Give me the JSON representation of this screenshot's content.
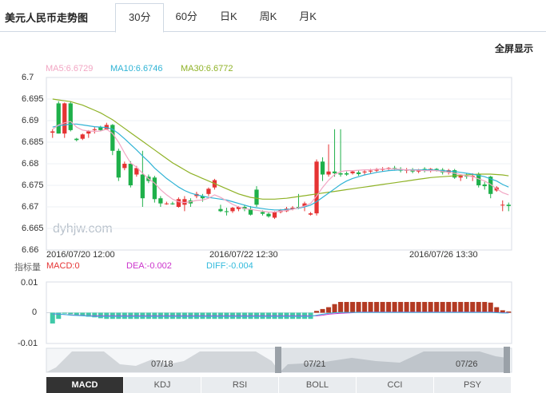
{
  "title": "美元人民币走势图",
  "tabs": [
    {
      "label": "30分",
      "active": true
    },
    {
      "label": "60分",
      "active": false
    },
    {
      "label": "日K",
      "active": false
    },
    {
      "label": "周K",
      "active": false
    },
    {
      "label": "月K",
      "active": false
    }
  ],
  "fullscreen_label": "全屏显示",
  "watermark": "dyhjw.com",
  "legend": {
    "ma5": "MA5:6.6729",
    "ma10": "MA10:6.6746",
    "ma30": "MA30:6.6772"
  },
  "colors": {
    "up": "#e53333",
    "down": "#1fb04a",
    "ma5": "#f2a6c3",
    "ma10": "#2fb3d5",
    "ma30": "#8fb227",
    "dea": "#cc33cc",
    "diff": "#33bbdd",
    "macd_neg": "#3fc9a8",
    "macd_pos": "#b33a22"
  },
  "indicator": {
    "label": "指标量",
    "macd": "MACD:0",
    "dea": "DEA:-0.002",
    "diff": "DIFF:-0.004"
  },
  "navigator_dates": [
    "07/18",
    "07/21",
    "07/26"
  ],
  "bottom_tabs": [
    {
      "label": "MACD",
      "active": true
    },
    {
      "label": "KDJ",
      "active": false
    },
    {
      "label": "RSI",
      "active": false
    },
    {
      "label": "BOLL",
      "active": false
    },
    {
      "label": "CCI",
      "active": false
    },
    {
      "label": "PSY",
      "active": false
    }
  ],
  "chart_data": {
    "type": "candlestick",
    "y_ticks": [
      "6.7",
      "6.695",
      "6.69",
      "6.685",
      "6.68",
      "6.675",
      "6.67",
      "6.665",
      "6.66"
    ],
    "ylim": [
      6.66,
      6.7
    ],
    "x_ticks": [
      "2016/07/20 12:00",
      "2016/07/22 12:30",
      "2016/07/26 13:30"
    ],
    "candles": [
      [
        6.6872,
        6.688,
        6.686,
        6.6875
      ],
      [
        6.694,
        6.6945,
        6.687,
        6.687
      ],
      [
        6.687,
        6.6942,
        6.686,
        6.694
      ],
      [
        6.694,
        6.6945,
        6.6875,
        6.6878
      ],
      [
        6.6858,
        6.686,
        6.6852,
        6.6855
      ],
      [
        6.6858,
        6.687,
        6.6855,
        6.6868
      ],
      [
        6.687,
        6.6878,
        6.686,
        6.6875
      ],
      [
        6.6878,
        6.6885,
        6.687,
        6.688
      ],
      [
        6.6885,
        6.6888,
        6.6875,
        6.6878
      ],
      [
        6.688,
        6.6895,
        6.6878,
        6.689
      ],
      [
        6.689,
        6.6892,
        6.682,
        6.683
      ],
      [
        6.683,
        6.6835,
        6.676,
        6.6768
      ],
      [
        6.679,
        6.6805,
        6.6785,
        6.68
      ],
      [
        6.68,
        6.6806,
        6.6745,
        6.675
      ],
      [
        6.6775,
        6.6795,
        6.677,
        6.679
      ],
      [
        6.6775,
        6.683,
        6.67,
        6.672
      ],
      [
        6.677,
        6.6775,
        6.6755,
        6.676
      ],
      [
        6.6768,
        6.6772,
        6.671,
        6.6718
      ],
      [
        6.672,
        6.6725,
        6.67,
        6.6708
      ],
      [
        6.6708,
        6.6712,
        6.6705,
        6.6708
      ],
      [
        6.6708,
        6.6712,
        6.6705,
        6.6706
      ],
      [
        6.67,
        6.6722,
        6.6698,
        6.6718
      ],
      [
        6.6705,
        6.6725,
        6.669,
        6.6718
      ],
      [
        6.6715,
        6.672,
        6.67,
        6.6708
      ],
      [
        6.6725,
        6.6735,
        6.672,
        6.673
      ],
      [
        6.6725,
        6.673,
        6.6712,
        6.672
      ],
      [
        6.673,
        6.6745,
        6.6725,
        6.6742
      ],
      [
        6.6745,
        6.6765,
        6.674,
        6.6762
      ],
      [
        6.6695,
        6.6705,
        6.6688,
        6.669
      ],
      [
        6.669,
        6.6698,
        6.668,
        6.6688
      ],
      [
        6.669,
        6.67,
        6.6686,
        6.6698
      ],
      [
        6.6695,
        6.6702,
        6.669,
        6.67
      ],
      [
        6.67,
        6.6705,
        6.669,
        6.6695
      ],
      [
        6.6695,
        6.6702,
        6.668,
        6.6682
      ],
      [
        6.674,
        6.6748,
        6.67,
        6.6705
      ],
      [
        6.6688,
        6.6692,
        6.668,
        6.6684
      ],
      [
        6.6684,
        6.6688,
        6.6675,
        6.6678
      ],
      [
        6.6675,
        6.669,
        6.6672,
        6.6688
      ],
      [
        6.6688,
        6.6695,
        6.6685,
        6.6692
      ],
      [
        6.669,
        6.67,
        6.6688,
        6.6696
      ],
      [
        6.6695,
        6.6702,
        6.6692,
        6.6698
      ],
      [
        6.67,
        6.673,
        6.6695,
        6.6698
      ],
      [
        6.67,
        6.6712,
        6.669,
        6.6708
      ],
      [
        6.6682,
        6.6688,
        6.668,
        6.6685
      ],
      [
        6.6685,
        6.681,
        6.668,
        6.6805
      ],
      [
        6.6805,
        6.6815,
        6.676,
        6.6775
      ],
      [
        6.6775,
        6.6845,
        6.677,
        6.6782
      ],
      [
        6.6782,
        6.688,
        6.677,
        6.6778
      ],
      [
        6.6778,
        6.688,
        6.677,
        6.6775
      ],
      [
        6.6778,
        6.6782,
        6.6772,
        6.6775
      ],
      [
        6.6778,
        6.6785,
        6.6775,
        6.6782
      ],
      [
        6.678,
        6.6785,
        6.6772,
        6.6776
      ],
      [
        6.678,
        6.6785,
        6.6775,
        6.6782
      ],
      [
        6.6782,
        6.6788,
        6.6778,
        6.6784
      ],
      [
        6.6784,
        6.679,
        6.678,
        6.6786
      ],
      [
        6.6786,
        6.6792,
        6.6782,
        6.6788
      ],
      [
        6.6788,
        6.6792,
        6.6784,
        6.679
      ],
      [
        6.679,
        6.6795,
        6.6786,
        6.6788
      ],
      [
        6.6788,
        6.6792,
        6.678,
        6.6784
      ],
      [
        6.6784,
        6.679,
        6.6778,
        6.6786
      ],
      [
        6.6786,
        6.679,
        6.6778,
        6.6782
      ],
      [
        6.6782,
        6.6788,
        6.6778,
        6.6786
      ],
      [
        6.6788,
        6.6792,
        6.678,
        6.6784
      ],
      [
        6.6784,
        6.679,
        6.678,
        6.6788
      ],
      [
        6.6788,
        6.679,
        6.6782,
        6.6786
      ],
      [
        6.6786,
        6.679,
        6.6775,
        6.678
      ],
      [
        6.678,
        6.6788,
        6.6775,
        6.6785
      ],
      [
        6.6785,
        6.6788,
        6.6765,
        6.6768
      ],
      [
        6.6768,
        6.6775,
        6.676,
        6.6772
      ],
      [
        6.6772,
        6.6778,
        6.6765,
        6.677
      ],
      [
        6.677,
        6.6778,
        6.676,
        6.6772
      ],
      [
        6.6775,
        6.678,
        6.6745,
        6.675
      ],
      [
        6.6752,
        6.6758,
        6.674,
        6.6748
      ],
      [
        6.677,
        6.6772,
        6.672,
        6.673
      ],
      [
        6.6738,
        6.6748,
        6.6735,
        6.6745
      ],
      [
        6.6705,
        6.6715,
        6.669,
        6.6705
      ],
      [
        6.6705,
        6.671,
        6.669,
        6.6702
      ]
    ],
    "ma5": [
      6.688,
      6.689,
      6.6895,
      6.6898,
      6.6885,
      6.6878,
      6.6876,
      6.6875,
      6.6876,
      6.688,
      6.687,
      6.685,
      6.6825,
      6.6802,
      6.6792,
      6.6778,
      6.6765,
      6.6755,
      6.674,
      6.6728,
      6.6718,
      6.6712,
      6.671,
      6.6712,
      6.6715,
      6.6716,
      6.672,
      6.6728,
      6.6722,
      6.6714,
      6.6706,
      6.67,
      6.6696,
      6.6694,
      6.6692,
      6.669,
      6.6688,
      6.6688,
      6.669,
      6.6692,
      6.6694,
      6.6698,
      6.6702,
      6.6708,
      6.6725,
      6.6745,
      6.6762,
      6.6775,
      6.6782,
      6.6784,
      6.6784,
      6.6785,
      6.6786,
      6.6786,
      6.6787,
      6.6788,
      6.6788,
      6.6788,
      6.6787,
      6.6786,
      6.6785,
      6.6785,
      6.6784,
      6.6784,
      6.6784,
      6.6782,
      6.678,
      6.6778,
      6.6775,
      6.6772,
      6.677,
      6.6765,
      6.676,
      6.6752,
      6.6742,
      6.6733,
      6.6728
    ],
    "ma10": [
      6.6885,
      6.6888,
      6.689,
      6.6892,
      6.6892,
      6.689,
      6.6888,
      6.6886,
      6.6885,
      6.6884,
      6.688,
      6.687,
      6.6858,
      6.6845,
      6.6832,
      6.6818,
      6.6805,
      6.679,
      6.6778,
      6.6766,
      6.6756,
      6.6746,
      6.6738,
      6.6732,
      6.6728,
      6.6725,
      6.6722,
      6.672,
      6.6718,
      6.6716,
      6.6712,
      6.6708,
      6.6704,
      6.67,
      6.6698,
      6.6696,
      6.6694,
      6.6693,
      6.6693,
      6.6694,
      6.6695,
      6.6697,
      6.67,
      6.6704,
      6.6712,
      6.6722,
      6.6732,
      6.6742,
      6.6752,
      6.676,
      6.6766,
      6.677,
      6.6774,
      6.6777,
      6.678,
      6.6782,
      6.6784,
      6.6785,
      6.6786,
      6.6786,
      6.6786,
      6.6786,
      6.6786,
      6.6786,
      6.6785,
      6.6784,
      6.6783,
      6.6782,
      6.678,
      6.6778,
      6.6776,
      6.6773,
      6.677,
      6.6765,
      6.676,
      6.6752,
      6.6746
    ],
    "ma30": [
      6.695,
      6.6948,
      6.6946,
      6.6944,
      6.694,
      6.6936,
      6.693,
      6.6924,
      6.6918,
      6.691,
      6.6902,
      6.6892,
      6.6882,
      6.6872,
      6.6862,
      6.6852,
      6.6842,
      6.6832,
      6.6822,
      6.6812,
      6.6802,
      6.6794,
      6.6786,
      6.6778,
      6.6772,
      6.6766,
      6.676,
      6.6754,
      6.6748,
      6.6742,
      6.6736,
      6.673,
      6.6726,
      6.6722,
      6.672,
      6.6718,
      6.6718,
      6.6718,
      6.6719,
      6.672,
      6.6722,
      6.6724,
      6.6726,
      6.6728,
      6.673,
      6.6732,
      6.6734,
      6.6736,
      6.6738,
      6.674,
      6.6742,
      6.6744,
      6.6746,
      6.6748,
      6.675,
      6.6752,
      6.6754,
      6.6756,
      6.6758,
      6.676,
      6.6762,
      6.6764,
      6.6766,
      6.6768,
      6.6769,
      6.677,
      6.6771,
      6.6772,
      6.6773,
      6.6774,
      6.6775,
      6.6776,
      6.6776,
      6.6776,
      6.6775,
      6.6774,
      6.6772
    ],
    "macd": {
      "y_ticks": [
        "0.01",
        "0",
        "-0.01"
      ],
      "ylim": [
        -0.01,
        0.01
      ],
      "histogram": [
        -0.0035,
        -0.002,
        -0.0003,
        -0.0005,
        -0.0008,
        -0.001,
        -0.0013,
        -0.0015,
        -0.0018,
        -0.002,
        -0.002,
        -0.002,
        -0.002,
        -0.002,
        -0.002,
        -0.002,
        -0.002,
        -0.002,
        -0.002,
        -0.002,
        -0.002,
        -0.002,
        -0.002,
        -0.002,
        -0.002,
        -0.002,
        -0.002,
        -0.002,
        -0.002,
        -0.002,
        -0.002,
        -0.002,
        -0.002,
        -0.002,
        -0.002,
        -0.002,
        -0.002,
        -0.002,
        -0.002,
        -0.002,
        -0.002,
        -0.002,
        -0.002,
        -0.002,
        0.0006,
        0.0012,
        0.0018,
        0.0028,
        0.0035,
        0.0035,
        0.0035,
        0.0035,
        0.0035,
        0.0035,
        0.0035,
        0.0035,
        0.0035,
        0.0035,
        0.0035,
        0.0035,
        0.0035,
        0.0035,
        0.0035,
        0.0035,
        0.0035,
        0.0035,
        0.0035,
        0.0035,
        0.0035,
        0.0035,
        0.0035,
        0.0035,
        0.0035,
        0.0033,
        0.0018,
        0.0008,
        0.0004
      ],
      "dea": [
        -0.0004,
        -0.0005,
        -0.0006,
        -0.0007,
        -0.0008,
        -0.0009,
        -0.001,
        -0.001,
        -0.001,
        -0.001,
        -0.001,
        -0.001,
        -0.001,
        -0.001,
        -0.001,
        -0.001,
        -0.001,
        -0.001,
        -0.001,
        -0.001,
        -0.001,
        -0.001,
        -0.001,
        -0.001,
        -0.001,
        -0.001,
        -0.001,
        -0.001,
        -0.001,
        -0.001,
        -0.001,
        -0.001,
        -0.001,
        -0.001,
        -0.001,
        -0.001,
        -0.001,
        -0.001,
        -0.001,
        -0.001,
        -0.001,
        -0.001,
        -0.001,
        -0.001,
        -0.001,
        -0.0008,
        -0.0005,
        -0.0003,
        -0.0002,
        -0.0001,
        0.0,
        0.0002,
        0.0002,
        0.0002,
        0.0002,
        0.0002,
        0.0002,
        0.0002,
        0.0002,
        0.0002,
        0.0002,
        0.0002,
        0.0002,
        0.0002,
        0.0002,
        0.0002,
        0.0002,
        0.0002,
        0.0002,
        0.0002,
        0.0002,
        0.0002,
        0.0002,
        0.0002,
        0.0001,
        0.0,
        0.0
      ],
      "diff": [
        -0.0003,
        -0.0004,
        -0.0006,
        -0.0008,
        -0.0009,
        -0.001,
        -0.0011,
        -0.0012,
        -0.0012,
        -0.0012,
        -0.0012,
        -0.0012,
        -0.0012,
        -0.0012,
        -0.0012,
        -0.0012,
        -0.0012,
        -0.0012,
        -0.0012,
        -0.0012,
        -0.0012,
        -0.0012,
        -0.0012,
        -0.0012,
        -0.0012,
        -0.0012,
        -0.0012,
        -0.0012,
        -0.0012,
        -0.0012,
        -0.0012,
        -0.0012,
        -0.0012,
        -0.0012,
        -0.0012,
        -0.0012,
        -0.0012,
        -0.0012,
        -0.0012,
        -0.0012,
        -0.0012,
        -0.0012,
        -0.0012,
        -0.0012,
        -0.0008,
        -0.0005,
        -0.0002,
        0.0,
        0.0001,
        0.0001,
        0.0001,
        0.0001,
        0.0001,
        0.0001,
        0.0001,
        0.0001,
        0.0001,
        0.0001,
        0.0001,
        0.0001,
        0.0001,
        0.0001,
        0.0001,
        0.0001,
        0.0001,
        0.0001,
        0.0001,
        0.0001,
        0.0001,
        0.0001,
        0.0001,
        0.0001,
        0.0001,
        0.0001,
        0.0,
        -0.0001,
        -0.0001
      ]
    }
  }
}
